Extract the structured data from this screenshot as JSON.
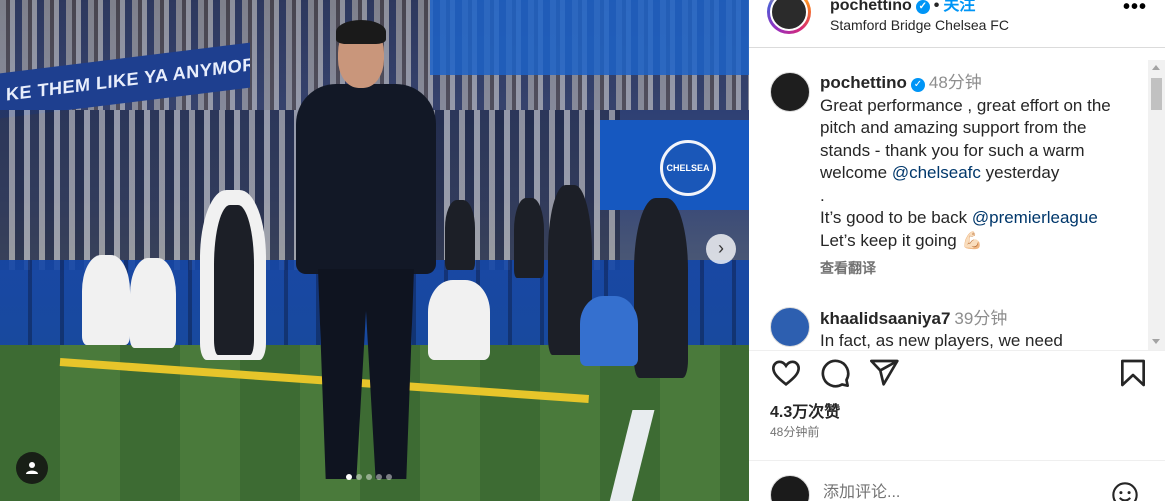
{
  "post": {
    "banner_text": "KE THEM LIKE YA ANYMORE",
    "badge_text": "CHELSEA",
    "carousel": {
      "slides": 5,
      "active": 0
    }
  },
  "header": {
    "username": "pochettino",
    "separator": "•",
    "follow_label": "关注",
    "location": "Stamford Bridge Chelsea FC",
    "more_label": "•••"
  },
  "caption": {
    "username": "pochettino",
    "time": "48分钟",
    "text_1": "Great performance , great effort on the pitch and amazing support from the stands - thank you for such a warm welcome ",
    "mention_1": "@chelseafc",
    "text_2": " yesterday",
    "text_3": ".",
    "text_4": "It’s good to be back ",
    "mention_2": "@premierleague",
    "text_5": "Let’s keep it going",
    "emoji": "💪🏻",
    "translate_label": "查看翻译"
  },
  "comment_2": {
    "username": "khaalidsaaniya7",
    "time": "39分钟",
    "text_partial": "In fact, as new players, we need"
  },
  "stats": {
    "likes": "4.3万次赞",
    "posted": "48分钟前"
  },
  "add_comment": {
    "placeholder": "添加评论..."
  },
  "colors": {
    "follow_blue": "#0095f6",
    "mention_blue": "#00376b",
    "verified_blue": "#0095f6"
  }
}
